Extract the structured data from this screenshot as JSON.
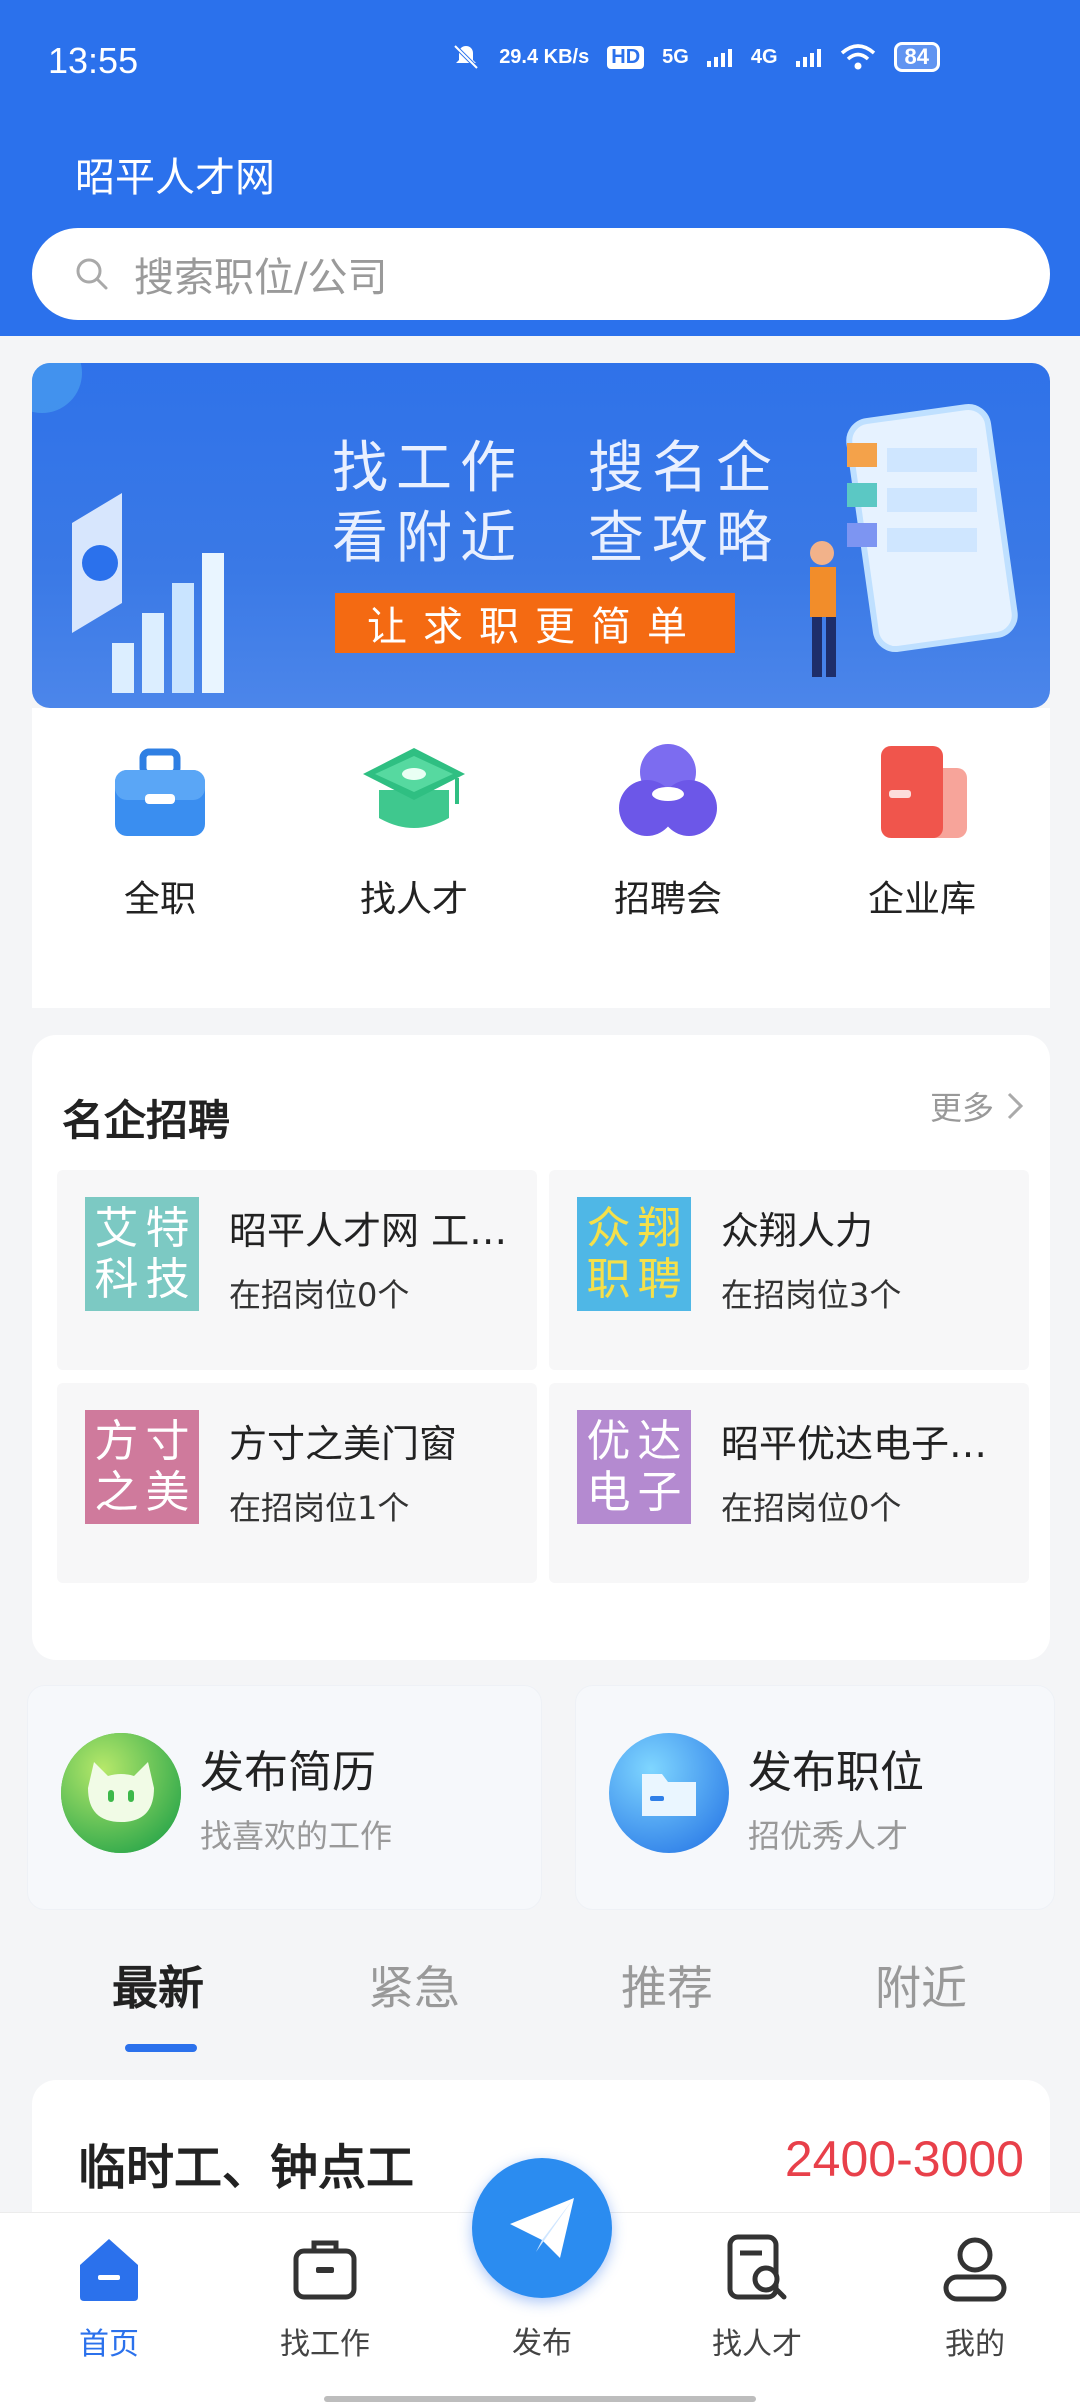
{
  "status_bar": {
    "time": "13:55",
    "net_speed": "29.4 KB/s",
    "hd": "HD",
    "signal_5g": "5G",
    "signal_4g": "4G",
    "battery": "84"
  },
  "header": {
    "title": "昭平人才网",
    "search_placeholder": "搜索职位/公司"
  },
  "banner": {
    "line1": "找工作　搜名企",
    "line2": "看附近　查攻略",
    "cta": "让求职更简单"
  },
  "quick_links": [
    {
      "label": "全职",
      "icon": "briefcase-icon"
    },
    {
      "label": "找人才",
      "icon": "graduation-cap-icon"
    },
    {
      "label": "招聘会",
      "icon": "meeting-icon"
    },
    {
      "label": "企业库",
      "icon": "company-library-icon"
    }
  ],
  "famous_companies": {
    "title": "名企招聘",
    "more": "更多",
    "items": [
      {
        "name": "昭平人才网 工…",
        "sub": "在招岗位0个",
        "logo_chars": [
          "艾",
          "特",
          "科",
          "技"
        ],
        "logo_color": "#7cc9c3"
      },
      {
        "name": "众翔人力",
        "sub": "在招岗位3个",
        "logo_chars": [
          "众",
          "翔",
          "职",
          "聘"
        ],
        "logo_color": "#4fb7e6"
      },
      {
        "name": "方寸之美门窗",
        "sub": "在招岗位1个",
        "logo_chars": [
          "方",
          "寸",
          "之",
          "美"
        ],
        "logo_color": "#cf7a9c"
      },
      {
        "name": "昭平优达电子…",
        "sub": "在招岗位0个",
        "logo_chars": [
          "优",
          "达",
          "电",
          "子"
        ],
        "logo_color": "#b48ad0"
      }
    ]
  },
  "publish": {
    "resume": {
      "title": "发布简历",
      "sub": "找喜欢的工作"
    },
    "job": {
      "title": "发布职位",
      "sub": "招优秀人才"
    }
  },
  "tabs": [
    {
      "label": "最新"
    },
    {
      "label": "紧急"
    },
    {
      "label": "推荐"
    },
    {
      "label": "附近"
    }
  ],
  "job_listing": {
    "title": "临时工、钟点工",
    "salary": "2400-3000"
  },
  "bottom_nav": {
    "home": "首页",
    "find_job": "找工作",
    "publish": "发布",
    "find_talent": "找人才",
    "mine": "我的"
  },
  "colors": {
    "brand": "#2b71ec",
    "salary": "#e8404a",
    "banner_cta": "#f46a12"
  }
}
